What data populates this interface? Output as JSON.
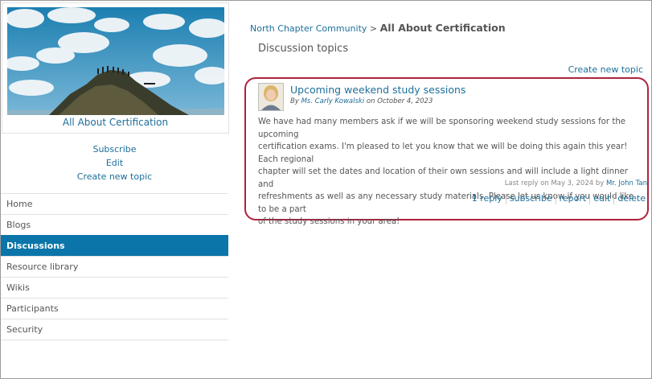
{
  "community": {
    "name": "All About Certification",
    "breadcrumb_parent": "North Chapter Community",
    "breadcrumb_sep": ">"
  },
  "sidebar": {
    "actions": [
      "Subscribe",
      "Edit",
      "Create new topic"
    ],
    "nav": [
      {
        "label": "Home",
        "active": false
      },
      {
        "label": "Blogs",
        "active": false
      },
      {
        "label": "Discussions",
        "active": true
      },
      {
        "label": "Resource library",
        "active": false
      },
      {
        "label": "Wikis",
        "active": false
      },
      {
        "label": "Participants",
        "active": false
      },
      {
        "label": "Security",
        "active": false
      }
    ]
  },
  "main": {
    "section_title": "Discussion topics",
    "create_link": "Create new topic",
    "topic": {
      "title": "Upcoming weekend study sessions",
      "by_prefix": "By",
      "author": "Ms. Carly Kowalski",
      "date_prefix": "on",
      "date": "October 4, 2023",
      "body_lines": [
        "We have had many members ask if we will be sponsoring weekend study sessions for the upcoming",
        "certification exams. I'm pleased to let you know that we will be doing this again this year! Each regional",
        "chapter will set the dates and location of their own sessions and will include a light dinner and",
        "refreshments as well as any necessary study materials. Please let us know if you would like to be a part",
        "of the study sessions in your area!"
      ],
      "last_reply_prefix": "Last reply on May 3, 2024 by",
      "last_reply_user": "Mr. John Tan",
      "actions": {
        "replies": "1 reply",
        "subscribe": "subscribe",
        "report": "report",
        "edit": "edit",
        "delete": "delete"
      }
    }
  },
  "colors": {
    "link": "#1d6f9a",
    "nav_active": "#0b75a9",
    "highlight_outline": "#b0233c"
  }
}
